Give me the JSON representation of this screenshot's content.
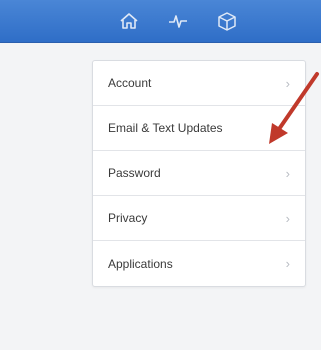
{
  "topbar": {
    "icons": [
      "home-icon",
      "activity-icon",
      "cube-icon"
    ]
  },
  "menu": {
    "items": [
      {
        "label": "Account",
        "chevron": "›"
      },
      {
        "label": "Email & Text Updates",
        "chevron": ""
      },
      {
        "label": "Password",
        "chevron": "›"
      },
      {
        "label": "Privacy",
        "chevron": "›"
      },
      {
        "label": "Applications",
        "chevron": "›"
      }
    ]
  },
  "annotation": {
    "arrow_color": "#c0392b"
  }
}
